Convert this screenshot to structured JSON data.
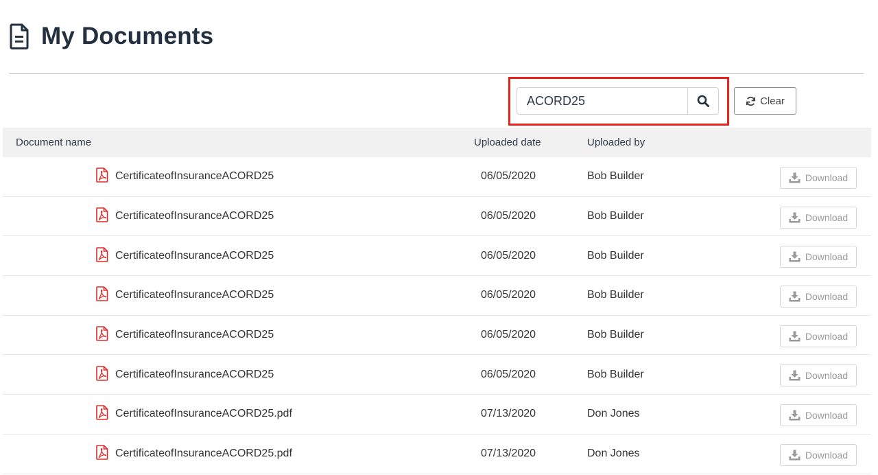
{
  "page": {
    "title": "My Documents",
    "title_icon": "document-icon"
  },
  "search": {
    "value": "ACORD25",
    "placeholder": "",
    "search_icon": "search-icon"
  },
  "clear_button": {
    "label": "Clear",
    "icon": "refresh-icon"
  },
  "table": {
    "columns": [
      "Document name",
      "Uploaded date",
      "Uploaded by"
    ],
    "rows": [
      {
        "name": "CertificateofInsuranceACORD25",
        "date": "06/05/2020",
        "by": "Bob Builder",
        "action": "Download"
      },
      {
        "name": "CertificateofInsuranceACORD25",
        "date": "06/05/2020",
        "by": "Bob Builder",
        "action": "Download"
      },
      {
        "name": "CertificateofInsuranceACORD25",
        "date": "06/05/2020",
        "by": "Bob Builder",
        "action": "Download"
      },
      {
        "name": "CertificateofInsuranceACORD25",
        "date": "06/05/2020",
        "by": "Bob Builder",
        "action": "Download"
      },
      {
        "name": "CertificateofInsuranceACORD25",
        "date": "06/05/2020",
        "by": "Bob Builder",
        "action": "Download"
      },
      {
        "name": "CertificateofInsuranceACORD25",
        "date": "06/05/2020",
        "by": "Bob Builder",
        "action": "Download"
      },
      {
        "name": "CertificateofInsuranceACORD25.pdf",
        "date": "07/13/2020",
        "by": "Don Jones",
        "action": "Download"
      },
      {
        "name": "CertificateofInsuranceACORD25.pdf",
        "date": "07/13/2020",
        "by": "Don Jones",
        "action": "Download"
      }
    ],
    "file_icon": "pdf-file-icon",
    "download_icon": "download-icon"
  },
  "colors": {
    "title": "#22303f",
    "highlight": "#e8231c",
    "pdf_icon": "#e02b2b",
    "header_bg": "#f1f1f1"
  }
}
